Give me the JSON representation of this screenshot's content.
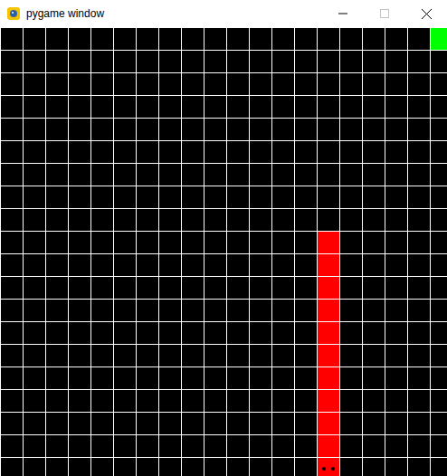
{
  "window": {
    "title": "pygame window"
  },
  "board": {
    "columns": 20,
    "rows": 20
  },
  "snake": {
    "color": "#ff0000",
    "segments": [
      {
        "col": 14,
        "row": 19,
        "kind": "head"
      },
      {
        "col": 14,
        "row": 18,
        "kind": "body"
      },
      {
        "col": 14,
        "row": 17,
        "kind": "body"
      },
      {
        "col": 14,
        "row": 16,
        "kind": "body"
      },
      {
        "col": 14,
        "row": 15,
        "kind": "body"
      },
      {
        "col": 14,
        "row": 14,
        "kind": "body"
      },
      {
        "col": 14,
        "row": 13,
        "kind": "body"
      },
      {
        "col": 14,
        "row": 12,
        "kind": "body"
      },
      {
        "col": 14,
        "row": 11,
        "kind": "body"
      },
      {
        "col": 14,
        "row": 10,
        "kind": "body"
      },
      {
        "col": 14,
        "row": 9,
        "kind": "body"
      }
    ]
  },
  "food": {
    "col": 19,
    "row": 0,
    "color": "#00ff00"
  },
  "window_controls": {
    "maximize_disabled": true
  }
}
